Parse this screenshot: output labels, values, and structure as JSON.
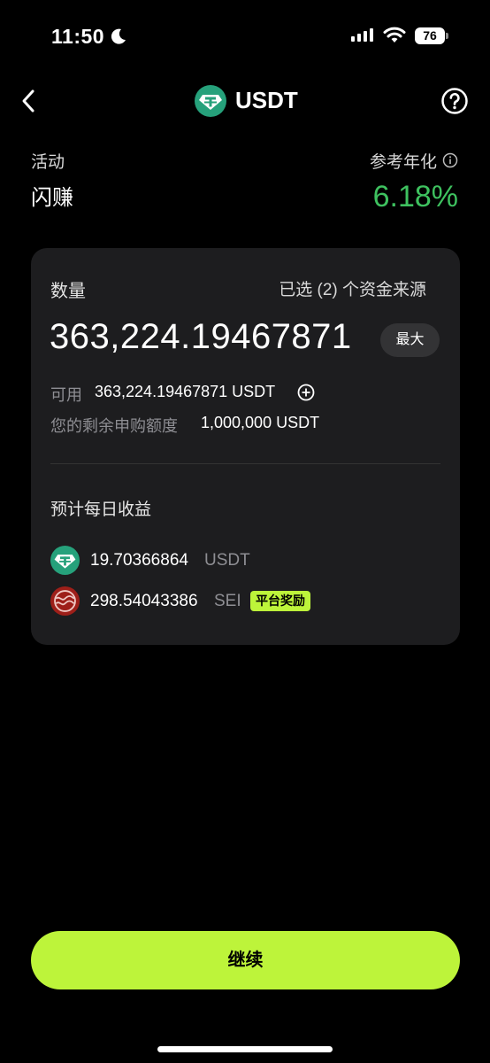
{
  "status_bar": {
    "time": "11:50",
    "battery": "76"
  },
  "header": {
    "title": "USDT"
  },
  "activity": {
    "label": "活动",
    "value": "闪赚"
  },
  "apr": {
    "label": "参考年化",
    "value": "6.18%"
  },
  "card": {
    "quantity_label": "数量",
    "source_select": "已选 (2) 个资金来源",
    "amount": "363,224.19467871",
    "max_label": "最大",
    "available_label": "可用",
    "available_value": "363,224.19467871 USDT",
    "quota_label": "您的剩余申购额度",
    "quota_value": "1,000,000 USDT",
    "estimated_label": "预计每日收益",
    "rewards": [
      {
        "amount": "19.70366864",
        "unit": "USDT",
        "icon": "usdt-icon"
      },
      {
        "amount": "298.54043386",
        "unit": "SEI",
        "icon": "sei-icon",
        "badge": "平台奖励"
      }
    ]
  },
  "continue_label": "继续",
  "colors": {
    "accent": "#bdf43a",
    "apr_green": "#3ec15f",
    "usdt_teal": "#26a17b",
    "sei_red": "#9e1f19",
    "card_bg": "#1d1d1f"
  }
}
